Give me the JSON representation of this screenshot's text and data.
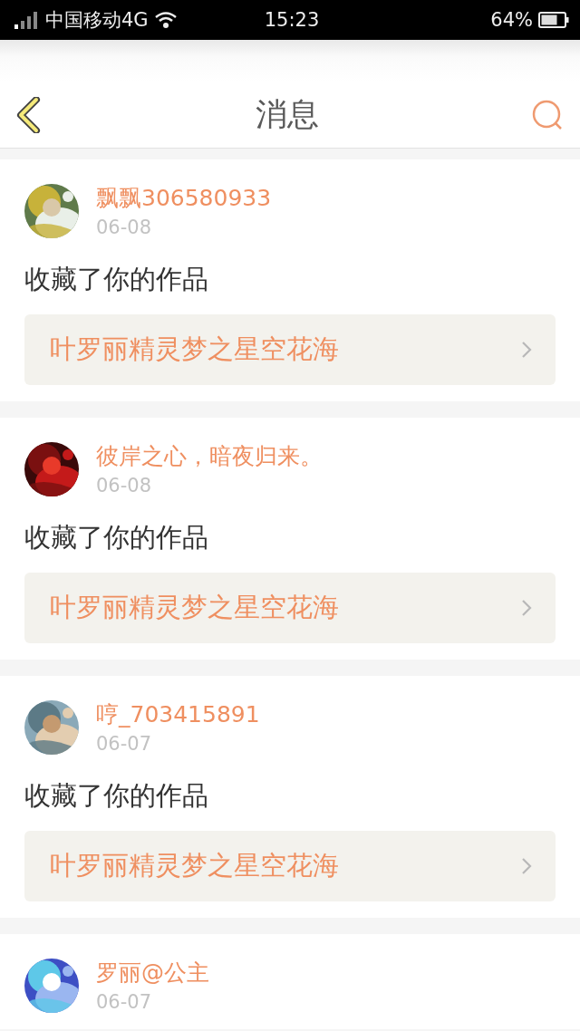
{
  "status_bar": {
    "carrier": "中国移动4G",
    "time": "15:23",
    "battery": "64%"
  },
  "header": {
    "title": "消息"
  },
  "messages": [
    {
      "user": "飘飘306580933",
      "date": "06-08",
      "action": "收藏了你的作品",
      "work": "叶罗丽精灵梦之星空花海"
    },
    {
      "user": "彼岸之心，暗夜归来。",
      "date": "06-08",
      "action": "收藏了你的作品",
      "work": "叶罗丽精灵梦之星空花海"
    },
    {
      "user": "哼_703415891",
      "date": "06-07",
      "action": "收藏了你的作品",
      "work": "叶罗丽精灵梦之星空花海"
    },
    {
      "user": "罗丽@公主",
      "date": "06-07"
    }
  ]
}
